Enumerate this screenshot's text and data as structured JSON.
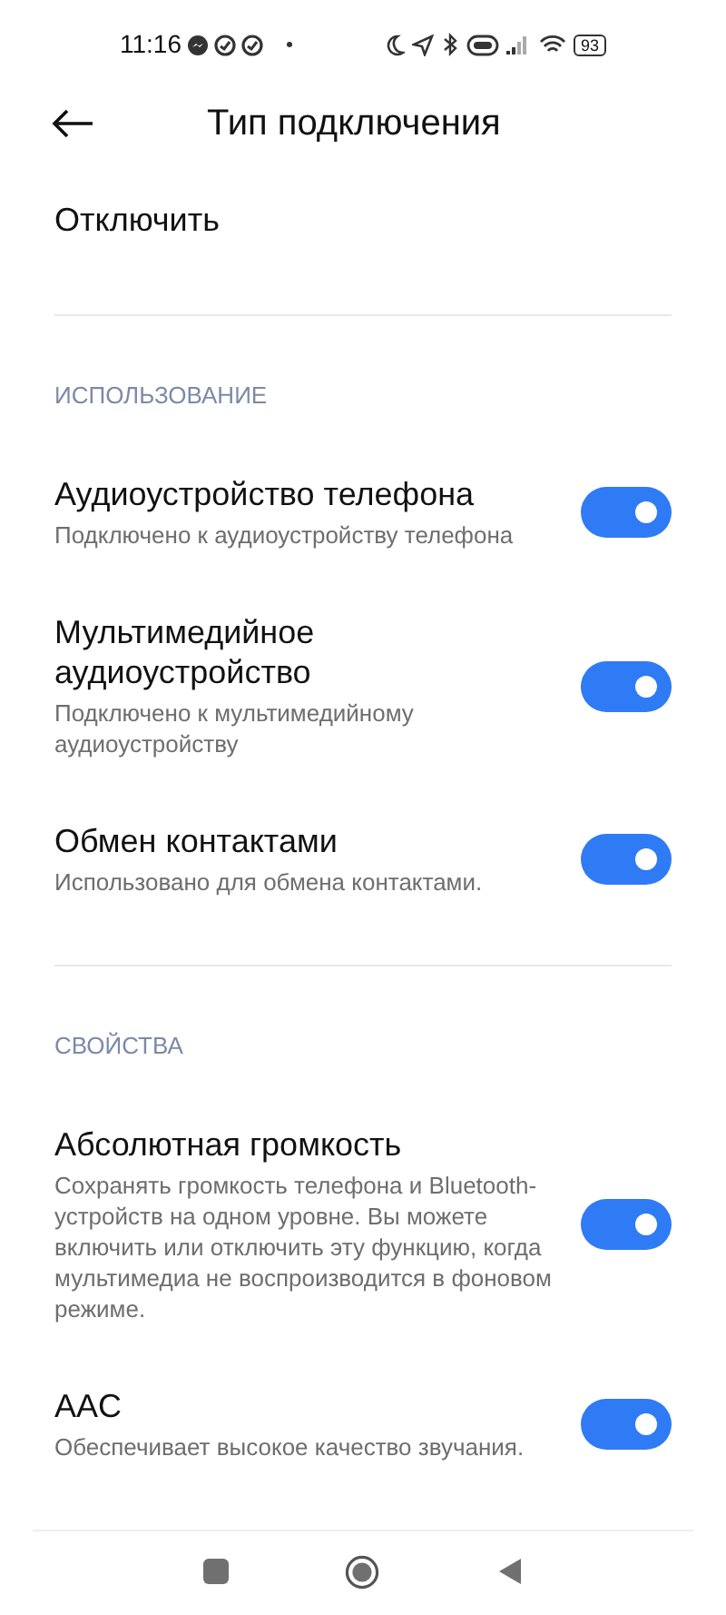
{
  "status_bar": {
    "time": "11:16",
    "battery": "93"
  },
  "header": {
    "title": "Тип подключения"
  },
  "disconnect": "Отключить",
  "sections": [
    {
      "title": "ИСПОЛЬЗОВАНИЕ",
      "items": [
        {
          "title": "Аудиоустройство телефона",
          "subtitle": "Подключено к аудиоустройству телефона",
          "on": true
        },
        {
          "title": "Мультимедийное аудиоустройство",
          "subtitle": "Подключено к мультимедийному аудиоустройству",
          "on": true
        },
        {
          "title": "Обмен контактами",
          "subtitle": "Использовано для обмена контактами.",
          "on": true
        }
      ]
    },
    {
      "title": "СВОЙСТВА",
      "items": [
        {
          "title": "Абсолютная громкость",
          "subtitle": "Сохранять громкость телефона и Bluetooth-устройств на одном уровне. Вы можете включить или отключить эту функцию, когда мультимедиа не воспроизводится в фоновом режиме.",
          "on": true
        },
        {
          "title": "AAC",
          "subtitle": "Обеспечивает высокое качество звучания.",
          "on": true
        }
      ]
    }
  ]
}
